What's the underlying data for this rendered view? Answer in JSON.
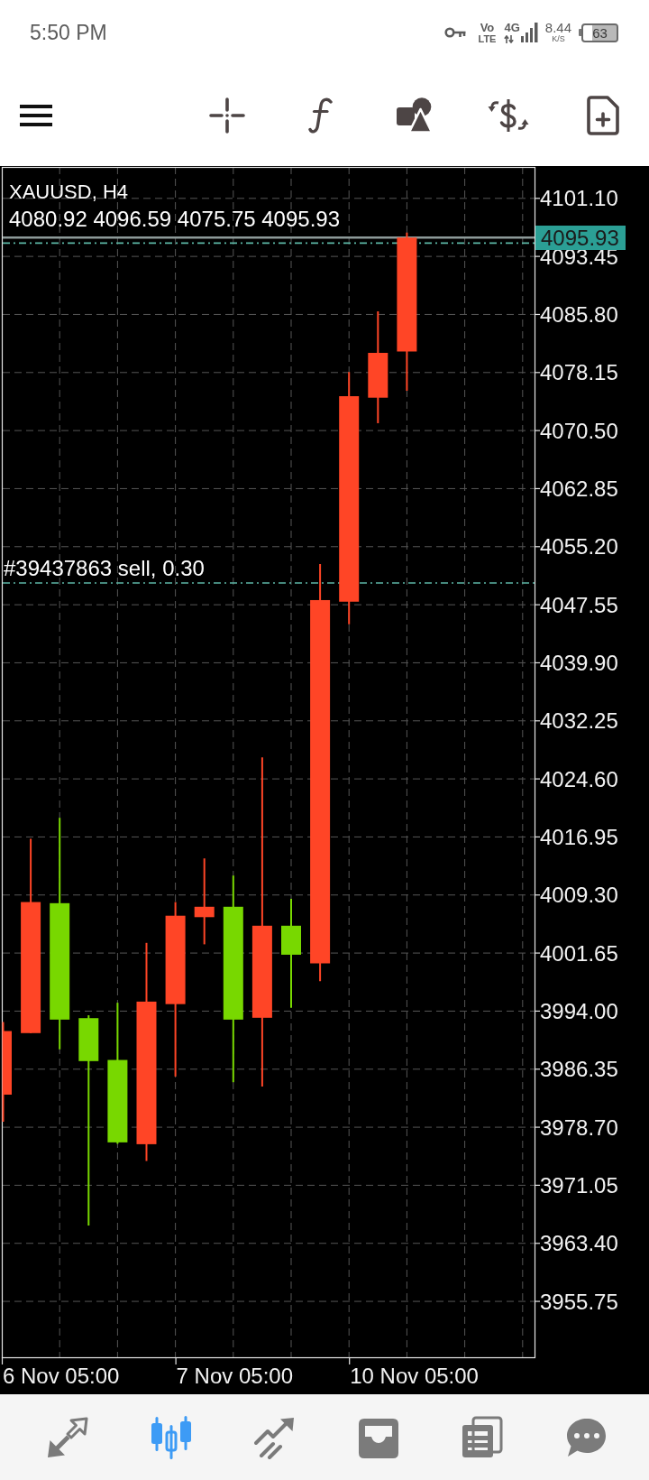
{
  "status_bar": {
    "time": "5:50 PM",
    "volte_top": "Vo",
    "volte_bottom": "LTE",
    "network": "4G",
    "speed": "8.44",
    "speed_unit": "K/S",
    "battery": "63"
  },
  "chart": {
    "symbol": "XAUUSD, H4",
    "ohlc": "4080.92 4096.59 4075.75 4095.93",
    "orders": [
      {
        "label": "#39437863 sell, 0.30"
      }
    ],
    "current_price": "4095.93",
    "price_labels": [
      "4101.10",
      "4093.45",
      "4085.80",
      "4078.15",
      "4070.50",
      "4062.85",
      "4055.20",
      "4047.55",
      "4039.90",
      "4032.25",
      "4024.60",
      "4016.95",
      "4009.30",
      "4001.65",
      "3994.00",
      "3986.35",
      "3978.70",
      "3971.05",
      "3963.40",
      "3955.75"
    ],
    "time_labels": [
      "6 Nov 05:00",
      "7 Nov 05:00",
      "10 Nov 05:00"
    ]
  },
  "bottom_nav": {
    "items": [
      {
        "selected": false
      },
      {
        "selected": true
      },
      {
        "selected": false
      },
      {
        "selected": false
      },
      {
        "selected": false
      },
      {
        "selected": false
      }
    ]
  }
}
